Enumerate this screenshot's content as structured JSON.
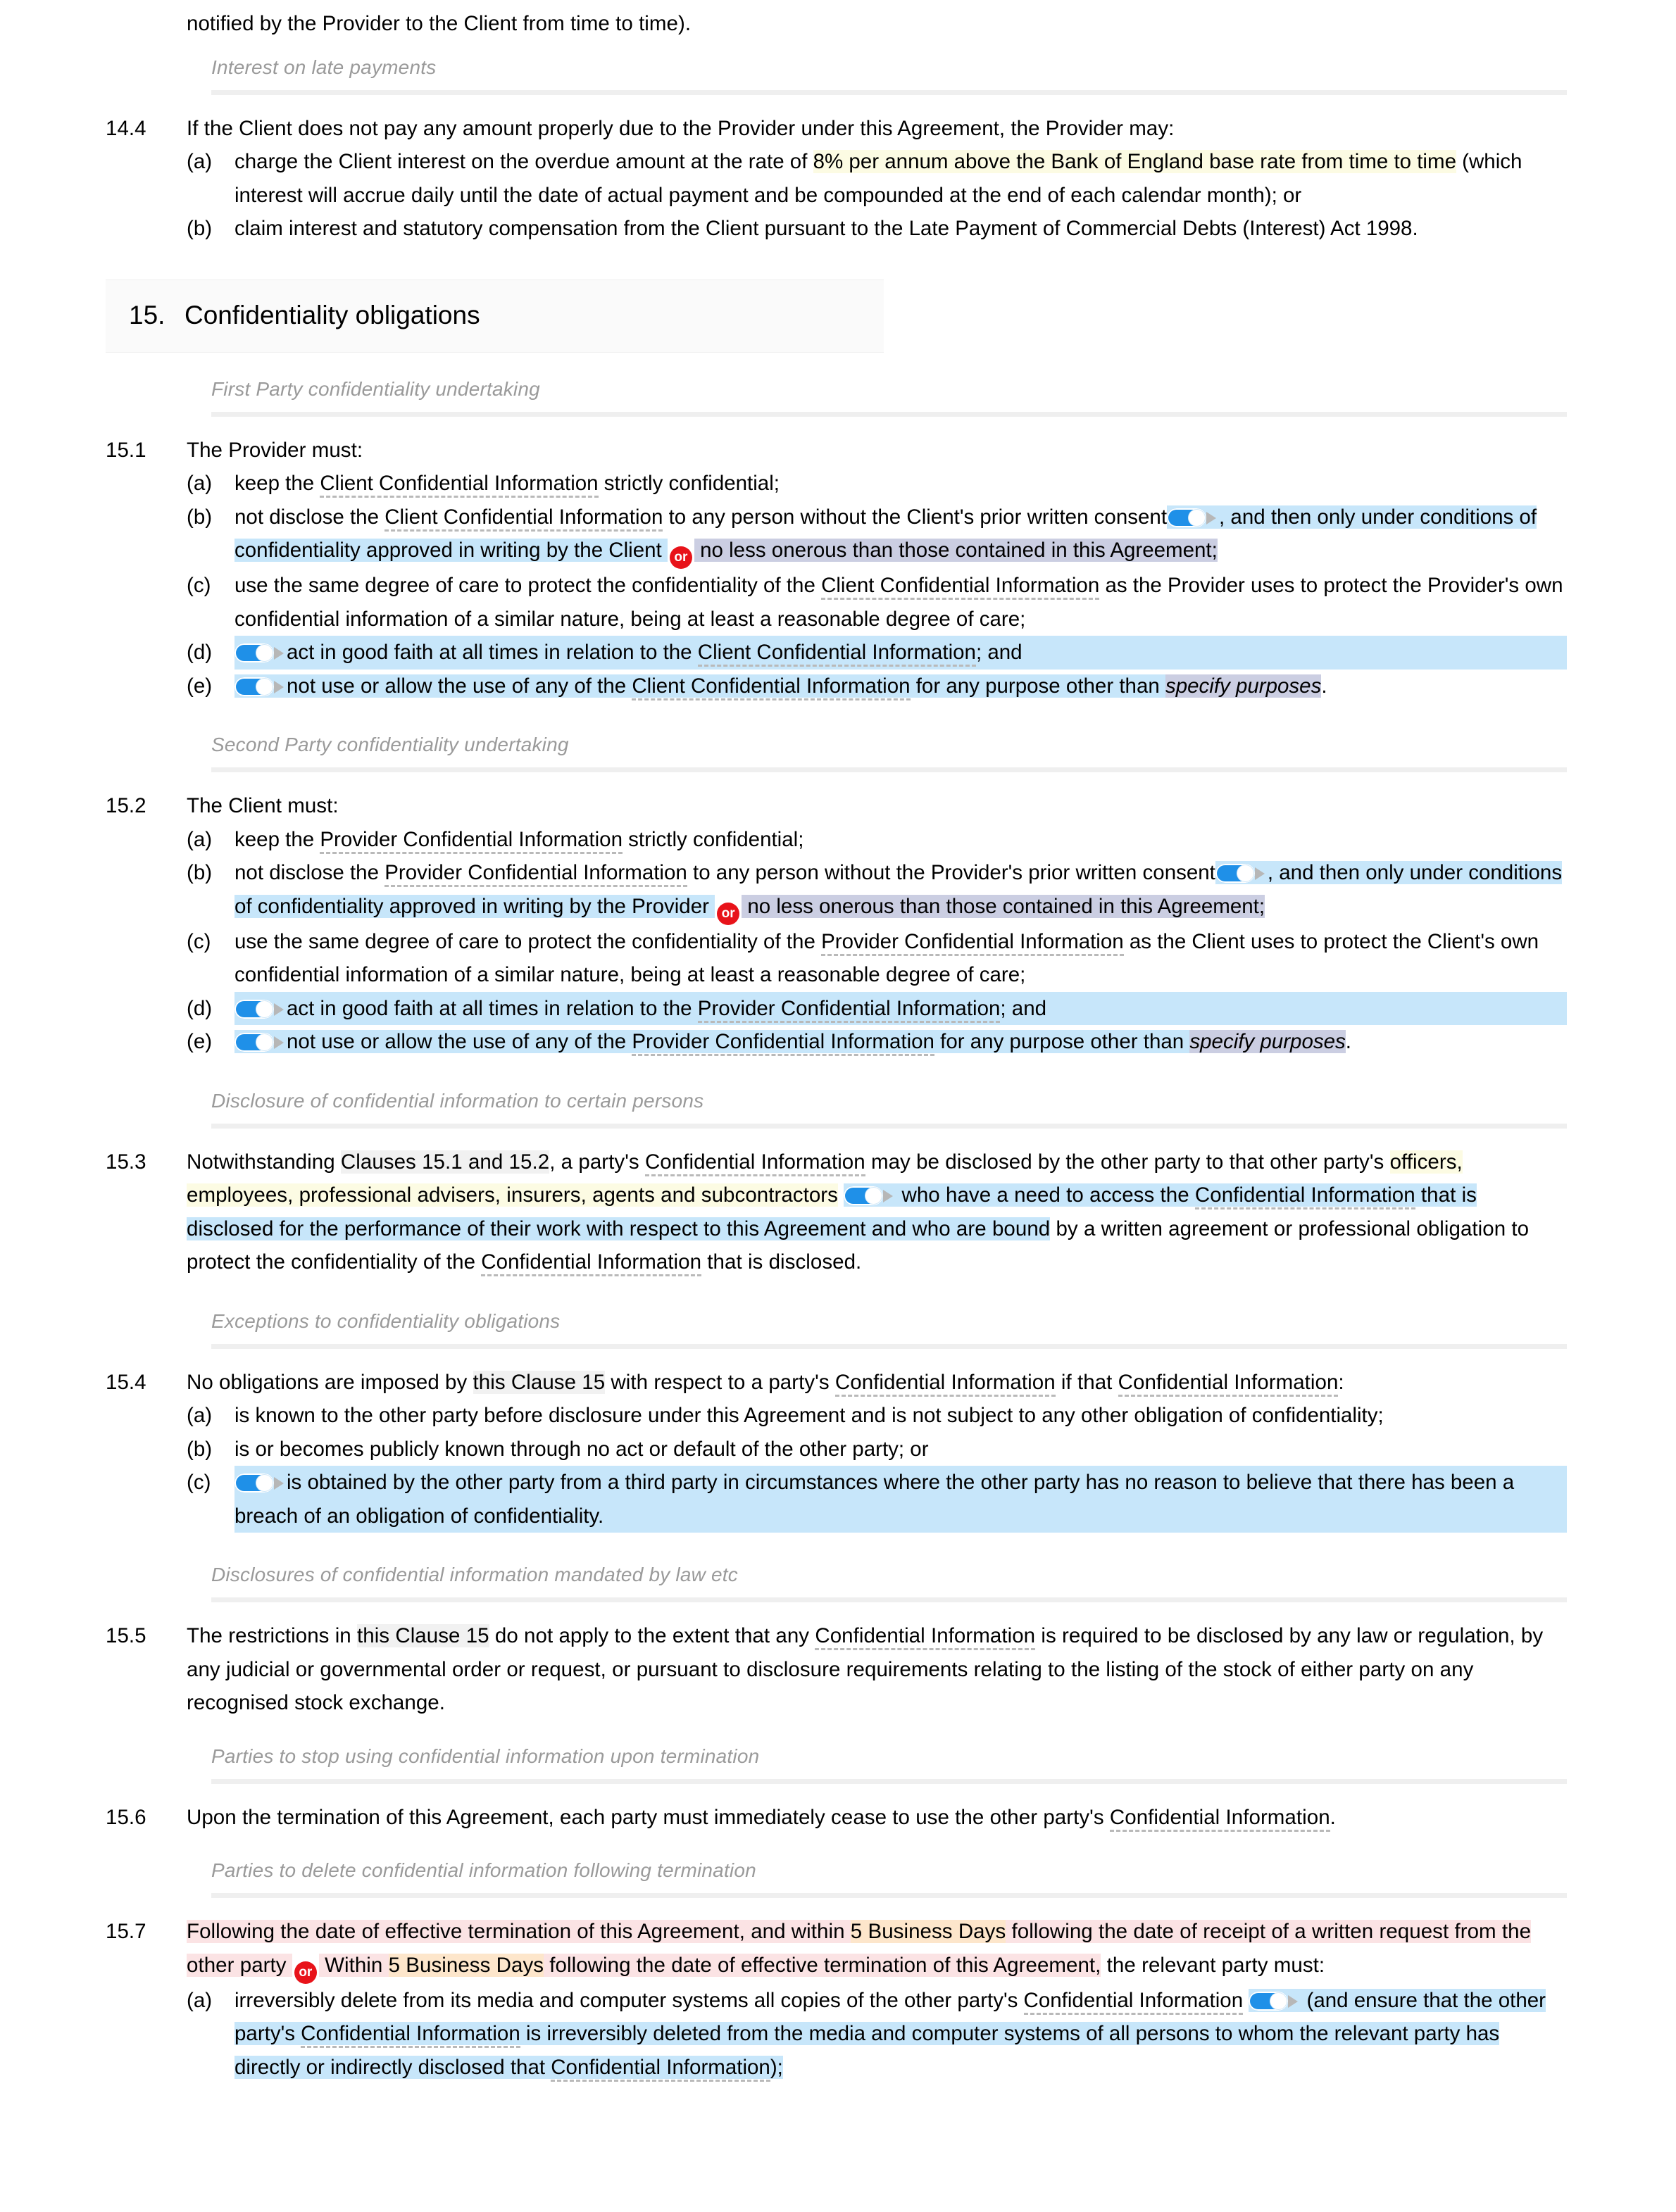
{
  "document": {
    "type": "legal-contract-editor",
    "colors": {
      "highlight_blue": "#c7e6fa",
      "highlight_yellow": "#fcfbe3",
      "highlight_lavender": "#cbcee2",
      "highlight_pink": "#fbe3e4",
      "highlight_orange": "#fde6cb",
      "xref_gray": "#f1f1f1",
      "toggle_on": "#1f90e8",
      "or_badge_red": "#e8131a",
      "side_heading_gray": "#9a9a9a",
      "rule_gray": "#efefef",
      "section_header_bg": "#fafafa",
      "term_underline": "#b9b9b9"
    }
  },
  "top_fragment": {
    "text": "notified by the Provider to the Client from time to time)."
  },
  "side_headings": {
    "interest": "Interest on late payments",
    "first_party": "First Party confidentiality undertaking",
    "second_party": "Second Party confidentiality undertaking",
    "disclosure": "Disclosure of confidential information to certain persons",
    "exceptions": "Exceptions to confidentiality obligations",
    "mandated": "Disclosures of confidential information mandated by law etc",
    "stop_using": "Parties to stop using confidential information upon termination",
    "delete": "Parties to delete confidential information following termination"
  },
  "section": {
    "number": "15.",
    "title": "Confidentiality obligations"
  },
  "clauses": {
    "c14_4": {
      "number": "14.4",
      "lead": "If the Client does not pay any amount properly due to the Provider under this Agreement, the Provider may:",
      "a": {
        "label": "(a)",
        "t1": "charge the Client interest on the overdue amount at the rate of ",
        "hl": "8% per annum above the Bank of England base rate from time to time",
        "t2": " (which interest will accrue daily until the date of actual payment and be compounded at the end of each calendar month); or"
      },
      "b": {
        "label": "(b)",
        "text": "claim interest and statutory compensation from the Client pursuant to the Late Payment of Commercial Debts (Interest) Act 1998."
      }
    },
    "c15_1": {
      "number": "15.1",
      "lead": "The Provider must:",
      "a": {
        "label": "(a)",
        "t1": "keep the ",
        "term": "Client Confidential Information",
        "t2": " strictly confidential;"
      },
      "b": {
        "label": "(b)",
        "t1": "not disclose the ",
        "term1": "Client Confidential Information",
        "t2": " to any person without the Client's prior written consent",
        "toggle": "toggle-switch-on",
        "t3": ", and then only under conditions of confidentiality approved in writing by the Client ",
        "or": "or",
        "t4": " no less onerous than those contained in this Agreement;"
      },
      "c": {
        "label": "(c)",
        "t1": "use the same degree of care to protect the confidentiality of the ",
        "term": "Client Confidential Information",
        "t2": " as the Provider uses to protect the Provider's own confidential information of a similar nature, being at least a reasonable degree of care;"
      },
      "d": {
        "label": "(d)",
        "toggle": "toggle-switch-on",
        "t1": "act in good faith at all times in relation to the ",
        "term": "Client Confidential Information",
        "t2": "; and"
      },
      "e": {
        "label": "(e)",
        "toggle": "toggle-switch-on",
        "t1": "not use or allow the use of any of the ",
        "term": "Client Confidential Information",
        "t2": " for any purpose other than ",
        "placeholder": "specify purposes",
        "t3": "."
      }
    },
    "c15_2": {
      "number": "15.2",
      "lead": "The Client must:",
      "a": {
        "label": "(a)",
        "t1": "keep the ",
        "term": "Provider Confidential Information",
        "t2": " strictly confidential;"
      },
      "b": {
        "label": "(b)",
        "t1": "not disclose the ",
        "term1": "Provider Confidential Information",
        "t2": " to any person without the Provider's prior written consent",
        "toggle": "toggle-switch-on",
        "t3": ", and then only under conditions of confidentiality approved in writing by the Provider ",
        "or": "or",
        "t4": " no less onerous than those contained in this Agreement;"
      },
      "c": {
        "label": "(c)",
        "t1": "use the same degree of care to protect the confidentiality of the ",
        "term": "Provider Confidential Information",
        "t2": " as the Client uses to protect the Client's own confidential information of a similar nature, being at least a reasonable degree of care;"
      },
      "d": {
        "label": "(d)",
        "toggle": "toggle-switch-on",
        "t1": "act in good faith at all times in relation to the ",
        "term": "Provider Confidential Information",
        "t2": "; and"
      },
      "e": {
        "label": "(e)",
        "toggle": "toggle-switch-on",
        "t1": "not use or allow the use of any of the ",
        "term": "Provider Confidential Information",
        "t2": " for any purpose other than ",
        "placeholder": "specify purposes",
        "t3": "."
      }
    },
    "c15_3": {
      "number": "15.3",
      "t1": "Notwithstanding ",
      "xref": "Clauses 15.1 and 15.2",
      "t2": ", a party's ",
      "term1": "Confidential Information",
      "t3": " may be disclosed by the other party to that other party's ",
      "hl_yellow": "officers, employees, professional advisers, insurers, agents and subcontractors",
      "toggle": "toggle-switch-on",
      "t4": " who have a need to access the ",
      "term2": "Confidential Information",
      "t5": " that is disclosed for the performance of their work with respect to this Agreement and who are bound by a written agreement or professional obligation to protect the confidentiality of the ",
      "term3": "Confidential Information",
      "t6": " that is disclosed."
    },
    "c15_4": {
      "number": "15.4",
      "t1": "No obligations are imposed by ",
      "xref": "this Clause 15",
      "t2": " with respect to a party's ",
      "term1": "Confidential Information",
      "t3": " if that ",
      "term2": "Confidential Information",
      "t4": ":",
      "a": {
        "label": "(a)",
        "text": "is known to the other party before disclosure under this Agreement and is not subject to any other obligation of confidentiality;"
      },
      "b": {
        "label": "(b)",
        "text": "is or becomes publicly known through no act or default of the other party; or"
      },
      "c": {
        "label": "(c)",
        "toggle": "toggle-switch-on",
        "text": "is obtained by the other party from a third party in circumstances where the other party has no reason to believe that there has been a breach of an obligation of confidentiality."
      }
    },
    "c15_5": {
      "number": "15.5",
      "t1": "The restrictions in ",
      "xref": "this Clause 15",
      "t2": " do not apply to the extent that any ",
      "term": "Confidential Information",
      "t3": " is required to be disclosed by any law or regulation, by any judicial or governmental order or request, or pursuant to disclosure requirements relating to the listing of the stock of either party on any recognised stock exchange."
    },
    "c15_6": {
      "number": "15.6",
      "t1": "Upon the termination of this Agreement, each party must immediately cease to use the other party's ",
      "term": "Confidential Information",
      "t2": "."
    },
    "c15_7": {
      "number": "15.7",
      "t1": "Following the date of effective termination of this Agreement, and within ",
      "days1": "5 Business Days",
      "t2": " following the date of receipt of a written request from the other party ",
      "or": "or",
      "t3": " Within ",
      "days2": "5 Business Days",
      "t4": " following the date of effective termination of this Agreement, the relevant party must:",
      "a": {
        "label": "(a)",
        "t1": "irreversibly delete from its media and computer systems all copies of the other party's ",
        "term1": "Confidential Information",
        "toggle": "toggle-switch-on",
        "t2": " (and ensure that the other party's ",
        "term2": "Confidential Information",
        "t3": " is irreversibly deleted from the media and computer systems of all persons to whom the relevant party has directly or indirectly disclosed that ",
        "term3": "Confidential Information",
        "t4": ");"
      }
    }
  }
}
